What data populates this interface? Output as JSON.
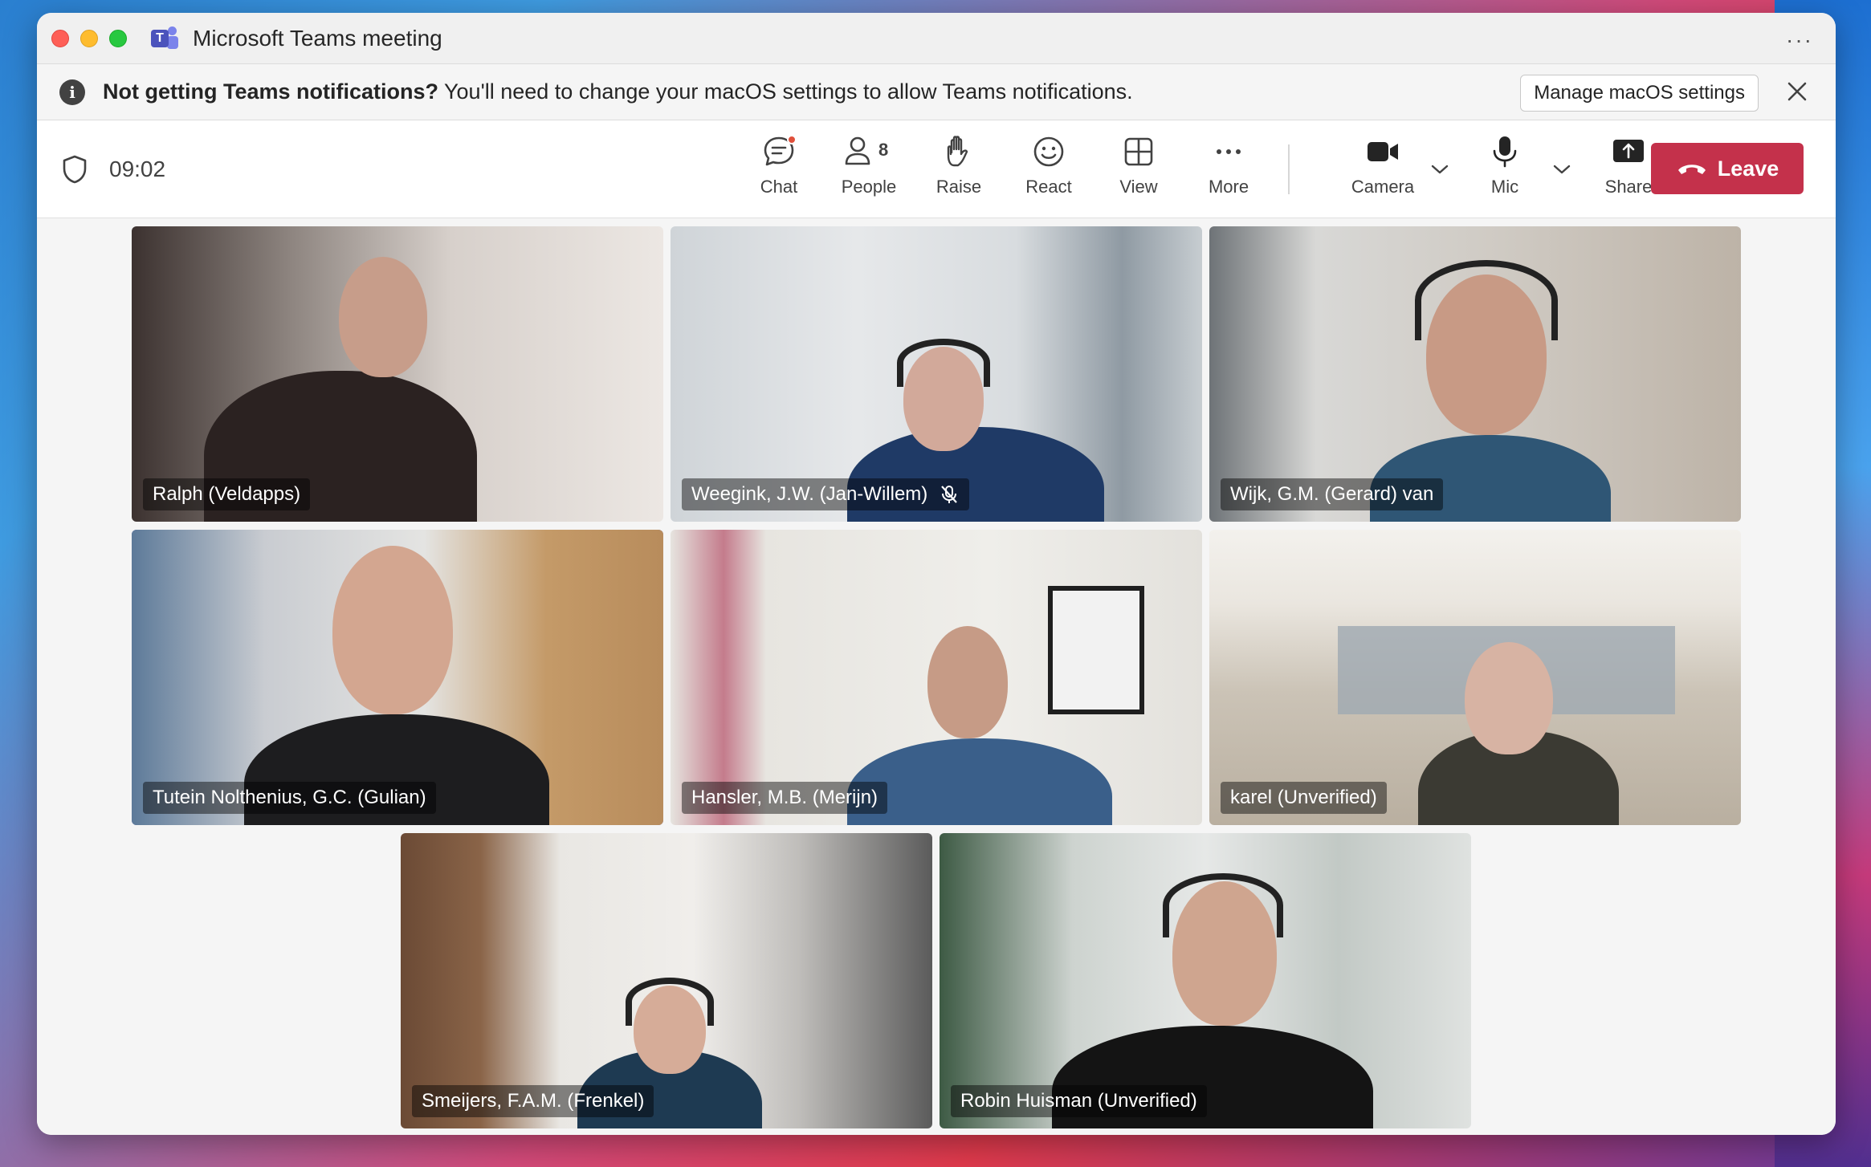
{
  "window": {
    "title": "Microsoft Teams meeting",
    "more_label": "···"
  },
  "notification": {
    "bold_text": "Not getting Teams notifications?",
    "text": " You'll need to change your macOS settings to allow Teams notifications.",
    "manage_button": "Manage macOS settings",
    "info_glyph": "i"
  },
  "toolbar": {
    "timer": "09:02",
    "people_count": "8",
    "buttons": {
      "chat": "Chat",
      "people": "People",
      "raise": "Raise",
      "react": "React",
      "view": "View",
      "more": "More",
      "camera": "Camera",
      "mic": "Mic",
      "share": "Share"
    },
    "leave": "Leave",
    "leave_color": "#c4314b",
    "chat_has_unread": true
  },
  "participants": [
    {
      "name": "Ralph (Veldapps)",
      "muted": false,
      "active_speaker": false
    },
    {
      "name": "Weegink, J.W. (Jan-Willem)",
      "muted": true,
      "active_speaker": false
    },
    {
      "name": "Wijk, G.M. (Gerard) van",
      "muted": false,
      "active_speaker": false
    },
    {
      "name": "Tutein Nolthenius, G.C. (Gulian)",
      "muted": false,
      "active_speaker": true
    },
    {
      "name": "Hansler, M.B. (Merijn)",
      "muted": false,
      "active_speaker": false
    },
    {
      "name": "karel (Unverified)",
      "muted": false,
      "active_speaker": false
    },
    {
      "name": "Smeijers, F.A.M. (Frenkel)",
      "muted": false,
      "active_speaker": false
    },
    {
      "name": "Robin Huisman (Unverified)",
      "muted": false,
      "active_speaker": false
    }
  ],
  "colors": {
    "accent": "#5b5fc7",
    "teams_brand": "#4b53bc"
  }
}
